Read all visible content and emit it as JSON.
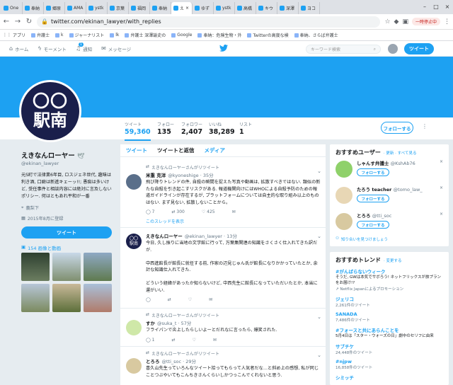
{
  "browser": {
    "tabs": [
      "One",
      "奉納",
      "郷原",
      "AMA",
      "ystk",
      "京葉",
      "福岡",
      "奉納",
      "え",
      "ゆず",
      "ystk",
      "高橋",
      "キウ",
      "深澤",
      "ヨコ"
    ],
    "active_tab_index": 8,
    "url": "twitter.com/ekinan_lawyer/with_replies",
    "paused_label": "一時停止中",
    "bookmarks": [
      "アプリ",
      "弁護士",
      "k",
      "ジャーナリスト",
      "lk",
      "弁護士 深澤諭史の",
      "Google",
      "奉納：危険生物・外",
      "Twitterの高度な検",
      "奉納、さらば弁護士"
    ]
  },
  "twitter_nav": {
    "home": "ホーム",
    "moments": "モーメント",
    "notifications": "通知",
    "notifications_badge": "1",
    "messages": "メッセージ",
    "search_placeholder": "キーワード検索",
    "tweet_button": "ツイート"
  },
  "colors": {
    "brand": "#1da1f2",
    "avatar_bg": "#1a1f4b"
  },
  "profile": {
    "avatar_top": "〇〇",
    "avatar_bottom": "駅南",
    "name": "えきなんローヤー",
    "handle": "@ekinan_lawyer",
    "bio": "元S町で法律業6年目, ロスジェネ世代, 趣味は利き酒, 口癖は新進キェーッ!!; 愚痴は多いけど, 受任事件と相談内容には絶対に言及しないポリシー. 何はともあれ平和が一番",
    "location": "義梨下",
    "joined": "2015年8月に登録",
    "tweet_button": "ツイート",
    "media_label": "154 画像と動画"
  },
  "stats": [
    {
      "label": "ツイート",
      "value": "59,360"
    },
    {
      "label": "フォロー",
      "value": "135"
    },
    {
      "label": "フォロワー",
      "value": "2,407"
    },
    {
      "label": "いいね",
      "value": "38,289"
    },
    {
      "label": "リスト",
      "value": "1"
    }
  ],
  "follow_button": "フォローする",
  "timeline_tabs": [
    "ツイート",
    "ツイートと返信",
    "メディア"
  ],
  "tweets": [
    {
      "retweet": "えきなんローヤーさんがリツイート",
      "name": "米重 克洋",
      "handle": "@kyoneshige · 35分",
      "body": "飛び降りトレンドの件, 自殺の瞬間を捉えた写真や動画は, 拡散すべきではない. 類似の新たな自殺を引き起こすリスクがある. 報道機関向けにはWHOによる自殺予防のための報道ガイドラインが存在するが, プラットフォームについては自主的な取り組み以上のものはない. まず見ない, 拡散しないことから。",
      "reply": "7",
      "retweets": "300",
      "likes": "425",
      "thread": "このスレッドを表示"
    },
    {
      "retweet": "",
      "name": "えきなんローヤー",
      "handle": "@ekinan_lawyer · 13分",
      "body": "今日, 久し振りに当地の文学館に行って, 万葉集関連の知識をさくさく仕入れてきた訳だが.\n\n中西進館長が館長に就任する前, 作家の辺見じゅん氏が館長になりかかっていたとか, 余計な知識仕入れてきた.\n\nどういう経緯があったか知らないけど, 中西先生に館長になっていただいたとか, 本当に運がいい.",
      "reply": "",
      "retweets": "",
      "likes": "",
      "thread": ""
    },
    {
      "retweet": "えきなんローヤーさんがリツイート",
      "name": "すか",
      "handle": "@suka_t · 57分",
      "body": "フライパンで炎上したらしいよーとだれなに言ったら, 爆笑された.",
      "reply": "1",
      "retweets": "",
      "likes": "",
      "thread": ""
    },
    {
      "retweet": "えきなんローヤーさんがリツイート",
      "name": "とろろ",
      "handle": "@tti_soc · 29分",
      "body": "喜久山先生っていろんなツイート拾ってもらって人気者だな…と斜め上の感想, 私が同じことつぶやいてもこんちきさんくらいしかつっこんでくれないと思う.",
      "reply": "",
      "retweets": "",
      "likes": "",
      "thread": ""
    }
  ],
  "suggested": {
    "title": "おすすめユーザー",
    "refresh": "· 更新 · すべて見る",
    "follow_label": "フォローする",
    "users": [
      {
        "name": "しゃんす弁護士",
        "handle": "@KshAb76"
      },
      {
        "name": "たろう teacher",
        "handle": "@tomo_law_"
      },
      {
        "name": "とろろ",
        "handle": "@tti_soc"
      }
    ],
    "find_friends": "知り合いを見つけましょう"
  },
  "trends": {
    "title": "おすすめトレンド",
    "change": "· 変更する",
    "items": [
      {
        "name": "#がんばらないウィーク",
        "desc": "そうだ, GWは本気でサボろう! ネットフリックスが旅プランをお届け!?",
        "count": "Netflix Japanによるプロモーション"
      },
      {
        "name": "ジェリコ",
        "desc": "",
        "count": "2,261件のツイート"
      },
      {
        "name": "SANADA",
        "desc": "",
        "count": "7,486件のツイート"
      },
      {
        "name": "#フォースと共にあらんことを",
        "desc": "5月4日は「スター・ウォーズの日」劇中のセリフに由来",
        "count": ""
      },
      {
        "name": "サブチケ",
        "desc": "",
        "count": "24,448件のツイート"
      },
      {
        "name": "#njpw",
        "desc": "",
        "count": "16,858件のツイート"
      },
      {
        "name": "シミッチ",
        "desc": "",
        "count": ""
      }
    ]
  }
}
